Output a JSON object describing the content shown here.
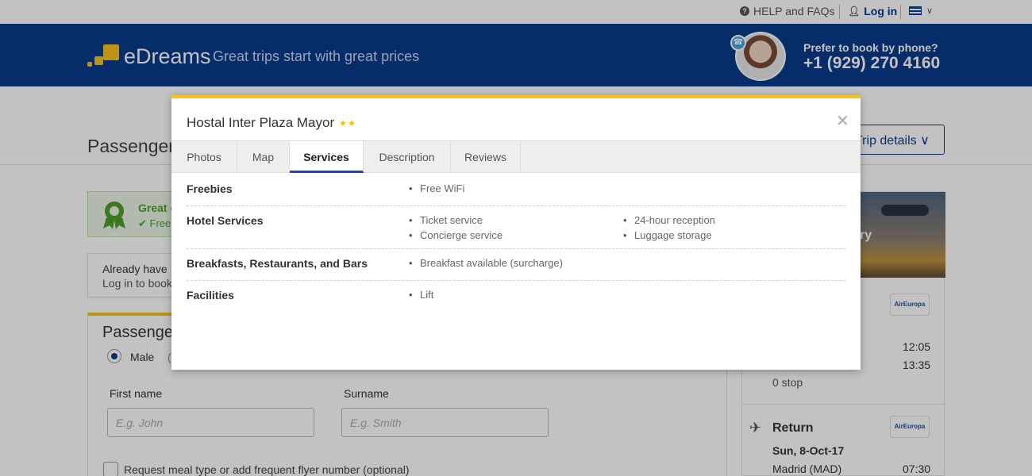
{
  "topbar": {
    "help_label": "HELP and FAQs",
    "login_label": "Log in"
  },
  "header": {
    "brand": "eDreams",
    "tagline": "Great trips start with great prices",
    "phone_prompt": "Prefer to book by phone?",
    "phone_number": "+1 (929) 270 4160",
    "colors": {
      "brand_blue": "#0a3a8c",
      "accent_yellow": "#f7c21a"
    }
  },
  "page": {
    "title": "Passengers",
    "trip_details_label": "Trip details"
  },
  "promo": {
    "title": "Great c",
    "subtitle": "✔ Free"
  },
  "account": {
    "line1": "Already have",
    "line2": "Log in to book"
  },
  "passenger_form": {
    "title": "Passenge",
    "gender_selected": "Male",
    "first_name_label": "First name",
    "first_name_placeholder": "E.g. John",
    "surname_label": "Surname",
    "surname_placeholder": "E.g. Smith",
    "meal_label": "Request meal type or add frequent flyer number (optional)"
  },
  "side_summary": {
    "photo_text": "ry",
    "outbound_airline": "AirEuropa",
    "depart_time": "12:05",
    "arrive_time": "13:35",
    "stops": "0 stop",
    "return_label": "Return",
    "return_date": "Sun, 8-Oct-17",
    "return_city": "Madrid (MAD)",
    "return_time": "07:30",
    "return_airline": "AirEuropa"
  },
  "modal": {
    "hotel_name": "Hostal Inter Plaza Mayor",
    "stars_text": "★★",
    "star_rating": 2,
    "close_icon": "close-icon",
    "tabs": [
      {
        "label": "Photos",
        "active": false
      },
      {
        "label": "Map",
        "active": false
      },
      {
        "label": "Services",
        "active": true
      },
      {
        "label": "Description",
        "active": false
      },
      {
        "label": "Reviews",
        "active": false
      }
    ],
    "services": [
      {
        "category": "Freebies",
        "items": [
          "Free WiFi"
        ]
      },
      {
        "category": "Hotel Services",
        "items": [
          "Ticket service",
          "24-hour reception",
          "Concierge service",
          "Luggage storage"
        ]
      },
      {
        "category": "Breakfasts, Restaurants, and Bars",
        "items": [
          "Breakfast available (surcharge)"
        ]
      },
      {
        "category": "Facilities",
        "items": [
          "Lift"
        ]
      }
    ]
  }
}
